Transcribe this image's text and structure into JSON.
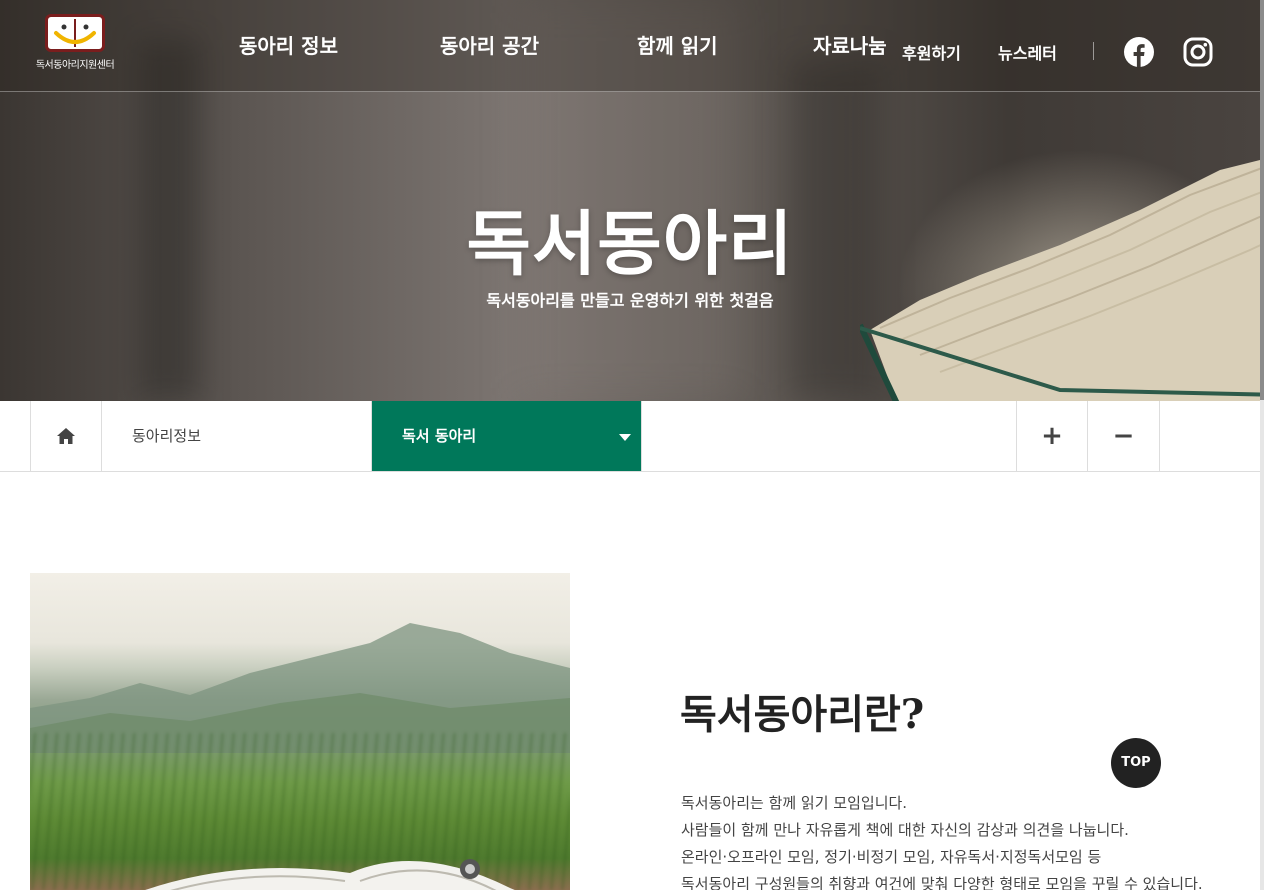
{
  "header": {
    "logo_text": "독서동아리지원센터",
    "nav": {
      "club_info": "동아리 정보",
      "club_space": "동아리 공간",
      "read_together": "함께 읽기",
      "resources": "자료나눔",
      "sponsor": "후원하기",
      "newsletter": "뉴스레터"
    },
    "sns": [
      "facebook-icon",
      "instagram-icon"
    ]
  },
  "hero": {
    "title": "독서동아리",
    "subtitle": "독서동아리를 만들고 운영하기 위한 첫걸음"
  },
  "breadcrumb": {
    "home_icon": "home-icon",
    "category": "동아리정보",
    "current": "독서 동아리",
    "zoom_in": "+",
    "zoom_out": "−"
  },
  "about": {
    "title": "독서동아리란?",
    "lines": [
      "독서동아리는 함께 읽기 모임입니다.",
      "사람들이 함께 만나 자유롭게 책에 대한 자신의 감상과 의견을 나눕니다.",
      "온라인·오프라인 모임, 정기·비정기 모임, 자유독서·지정독서모임 등",
      "독서동아리 구성원들의 취향과 여건에 맞춰 다양한 형태로 모임을 꾸릴 수 있습니다."
    ]
  },
  "top_button": "TOP",
  "colors": {
    "accent_green": "#00785a",
    "logo_red": "#7a1d1d"
  }
}
